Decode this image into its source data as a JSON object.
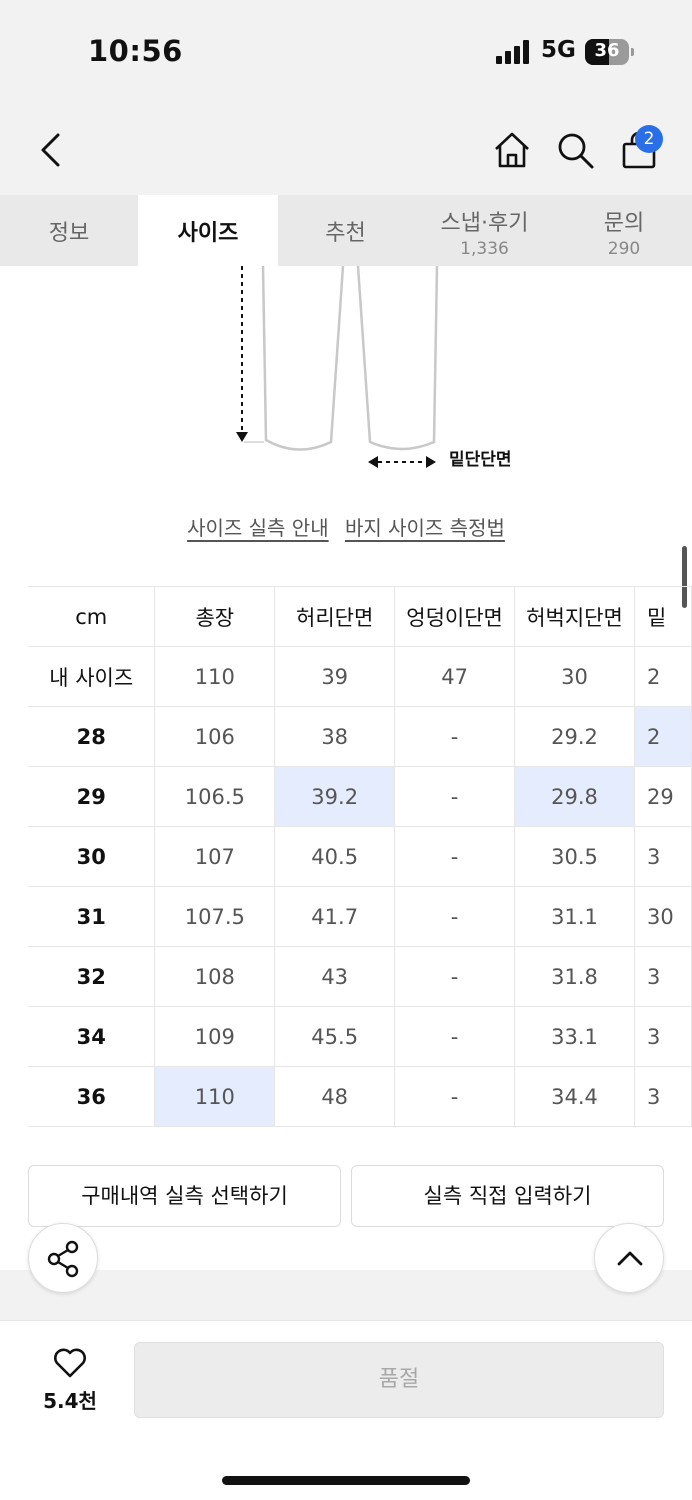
{
  "status_bar": {
    "time": "10:56",
    "network": "5G",
    "battery": "36"
  },
  "header": {
    "cart_count": "2"
  },
  "tabs": [
    {
      "label": "정보",
      "count": ""
    },
    {
      "label": "사이즈",
      "count": ""
    },
    {
      "label": "추천",
      "count": ""
    },
    {
      "label": "스냅·후기",
      "count": "1,336"
    },
    {
      "label": "문의",
      "count": "290"
    }
  ],
  "diagram": {
    "hem_label": "밑단단면"
  },
  "links": {
    "size_guide": "사이즈 실측 안내",
    "pants_measure": "바지 사이즈 측정법"
  },
  "size_table": {
    "headers": [
      "cm",
      "총장",
      "허리단면",
      "엉덩이단면",
      "허벅지단면",
      "밑"
    ],
    "rows": [
      [
        "내 사이즈",
        "110",
        "39",
        "47",
        "30",
        "2"
      ],
      [
        "28",
        "106",
        "38",
        "-",
        "29.2",
        "2"
      ],
      [
        "29",
        "106.5",
        "39.2",
        "-",
        "29.8",
        "29"
      ],
      [
        "30",
        "107",
        "40.5",
        "-",
        "30.5",
        "3"
      ],
      [
        "31",
        "107.5",
        "41.7",
        "-",
        "31.1",
        "30"
      ],
      [
        "32",
        "108",
        "43",
        "-",
        "31.8",
        "3"
      ],
      [
        "34",
        "109",
        "45.5",
        "-",
        "33.1",
        "3"
      ],
      [
        "36",
        "110",
        "48",
        "-",
        "34.4",
        "3"
      ]
    ]
  },
  "buttons": {
    "purchase_history": "구매내역 실측 선택하기",
    "direct_input": "실측 직접 입력하기"
  },
  "bottom": {
    "likes": "5.4천",
    "soldout": "품절"
  },
  "colors": {
    "accent": "#2b6fe8",
    "highlight": "#e5ecfd"
  }
}
